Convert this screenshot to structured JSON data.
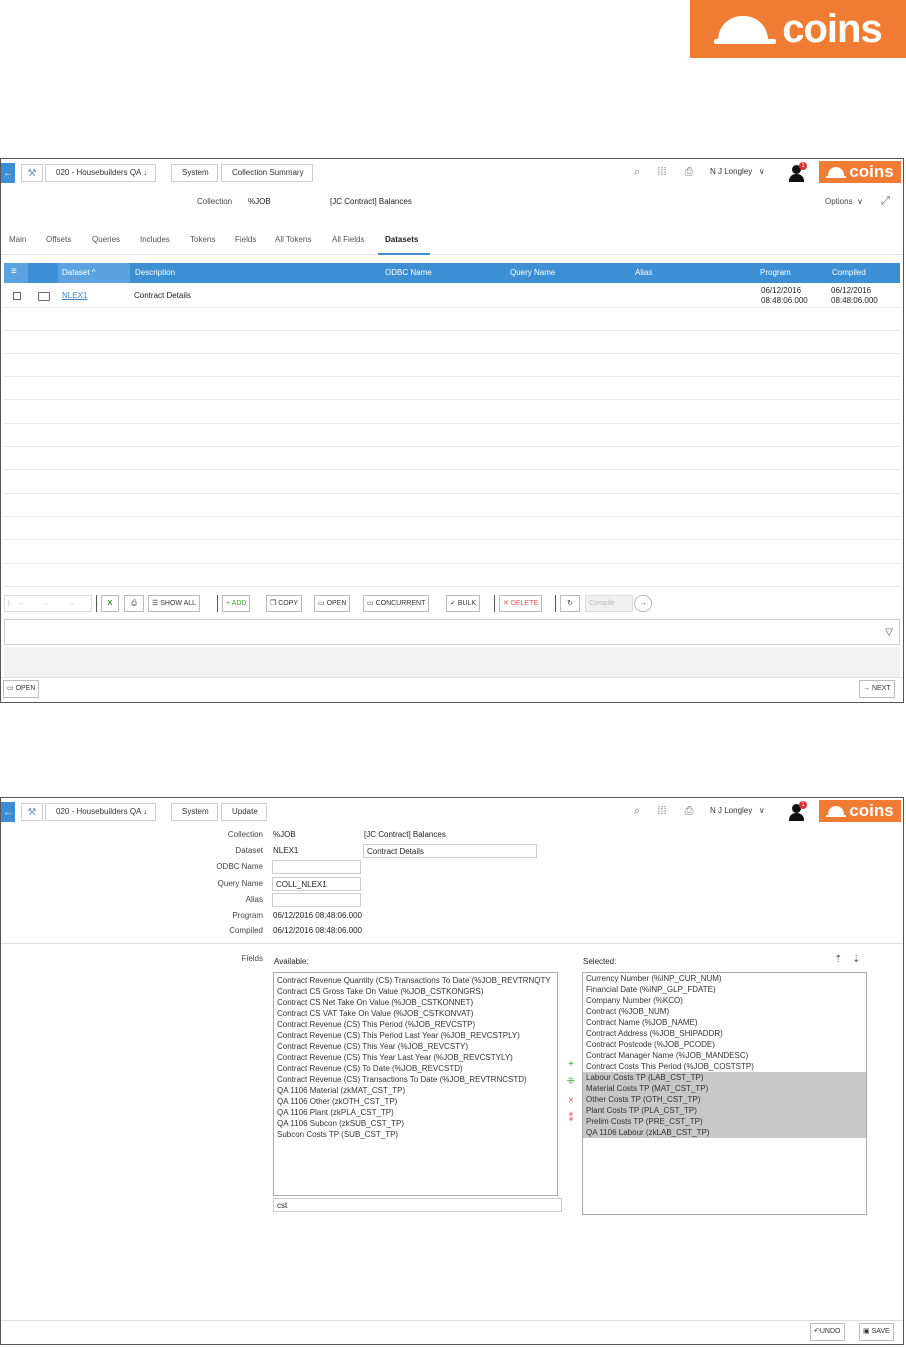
{
  "brand": {
    "logo_text": "coins",
    "color": "#f07c33"
  },
  "colors": {
    "accent": "#3d8fd4",
    "link": "#3d7fc4"
  },
  "header": {
    "crumb_company": "020 - Housebuilders QA",
    "crumb_system": "System",
    "user_name": "N J Longley",
    "notification_count": "1",
    "logo_text": "coins"
  },
  "screen1": {
    "crumb_page": "Collection Summary",
    "collection_label": "Collection",
    "collection_code": "%JOB",
    "collection_desc": "[JC Contract] Balances",
    "options_label": "Options",
    "tabs": [
      "Main",
      "Offsets",
      "Queries",
      "Includes",
      "Tokens",
      "Fields",
      "All Tokens",
      "All Fields",
      "Datasets"
    ],
    "active_tab": "Datasets",
    "columns": [
      "Dataset",
      "Description",
      "ODBC Name",
      "Query Name",
      "Alias",
      "Program",
      "Compiled"
    ],
    "rows": [
      {
        "dataset": "NLEX1",
        "description": "Contract Details",
        "odbc_name": "",
        "query_name": "",
        "alias": "",
        "program_date": "06/12/2016",
        "program_time": "08:48:06.000",
        "compiled_date": "06/12/2016",
        "compiled_time": "08:48:06.000"
      }
    ],
    "toolbar": {
      "show_all": "SHOW ALL",
      "add": "ADD",
      "copy": "COPY",
      "open": "OPEN",
      "concurrent": "CONCURRENT",
      "bulk": "BULK",
      "delete": "DELETE",
      "compile_placeholder": "Compile"
    },
    "footer": {
      "open": "OPEN",
      "next": "NEXT"
    }
  },
  "screen2": {
    "crumb_page": "Update",
    "form": {
      "collection_label": "Collection",
      "collection_code": "%JOB",
      "collection_desc": "[JC Contract] Balances",
      "dataset_label": "Dataset",
      "dataset_code": "NLEX1",
      "dataset_desc": "Contract Details",
      "odbc_label": "ODBC Name",
      "odbc_value": "",
      "query_label": "Query Name",
      "query_value": "COLL_NLEX1",
      "alias_label": "Alias",
      "alias_value": "",
      "program_label": "Program",
      "program_value": "06/12/2016 08:48:06.000",
      "compiled_label": "Compiled",
      "compiled_value": "06/12/2016 08:48:06.000"
    },
    "fields_label": "Fields",
    "available_label": "Available:",
    "selected_label": "Selected:",
    "available": [
      "Contract Revenue Quantity (CS) Transactions To Date (%JOB_REVTRNQTY",
      "Contract CS Gross Take On Value (%JOB_CSTKONGRS)",
      "Contract CS Net Take On Value (%JOB_CSTKONNET)",
      "Contract CS VAT Take On Value (%JOB_CSTKONVAT)",
      "Contract Revenue (CS) This Period (%JOB_REVCSTP)",
      "Contract Revenue (CS) This Period Last Year (%JOB_REVCSTPLY)",
      "Contract Revenue (CS) This Year (%JOB_REVCSTY)",
      "Contract Revenue (CS) This Year Last Year (%JOB_REVCSTYLY)",
      "Contract Revenue (CS) To Date (%JOB_REVCSTD)",
      "Contract Revenue (CS) Transactions To Date (%JOB_REVTRNCSTD)",
      "QA 1106 Material (zkMAT_CST_TP)",
      "QA 1106 Other (zkOTH_CST_TP)",
      "QA 1106 Plant (zkPLA_CST_TP)",
      "QA 1106 Subcon (zkSUB_CST_TP)",
      "Subcon Costs TP (SUB_CST_TP)"
    ],
    "selected": [
      {
        "text": "Currency Number (%INP_CUR_NUM)",
        "highlighted": false
      },
      {
        "text": "Financial Date (%INP_GLP_FDATE)",
        "highlighted": false
      },
      {
        "text": "Company Number (%KCO)",
        "highlighted": false
      },
      {
        "text": "Contract (%JOB_NUM)",
        "highlighted": false
      },
      {
        "text": "Contract Name (%JOB_NAME)",
        "highlighted": false
      },
      {
        "text": "Contract Address (%JOB_SHIPADDR)",
        "highlighted": false
      },
      {
        "text": "Contract Postcode (%JOB_PCODE)",
        "highlighted": false
      },
      {
        "text": "Contract Manager Name (%JOB_MANDESC)",
        "highlighted": false
      },
      {
        "text": "Contract Costs This Period (%JOB_COSTSTP)",
        "highlighted": false
      },
      {
        "text": "Labour Costs TP (LAB_CST_TP)",
        "highlighted": true
      },
      {
        "text": "Material Costs TP (MAT_CST_TP)",
        "highlighted": true
      },
      {
        "text": "Other Costs TP (OTH_CST_TP)",
        "highlighted": true
      },
      {
        "text": "Plant Costs TP (PLA_CST_TP)",
        "highlighted": true
      },
      {
        "text": "Prelim Costs TP (PRE_CST_TP)",
        "highlighted": true
      },
      {
        "text": "QA 1106 Labour (zkLAB_CST_TP)",
        "highlighted": true
      }
    ],
    "search_value": "cst",
    "footer": {
      "undo": "UNDO",
      "save": "SAVE"
    }
  }
}
